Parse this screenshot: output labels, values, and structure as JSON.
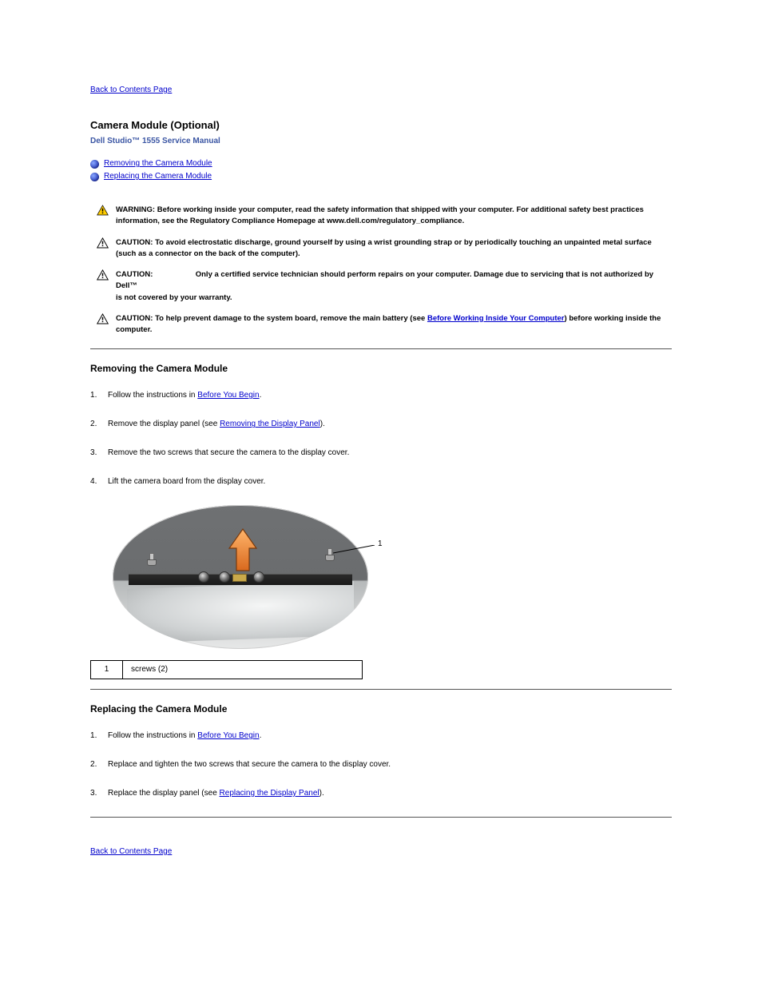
{
  "nav": {
    "back_top": "Back to Contents Page",
    "back_bottom": "Back to Contents Page"
  },
  "header": {
    "title": "Camera Module (Optional)",
    "subtitle": "Dell Studio™ 1555 Service Manual"
  },
  "toc": [
    {
      "label": "Removing the Camera Module"
    },
    {
      "label": "Replacing the Camera Module"
    }
  ],
  "notices": {
    "warning": "WARNING: Before working inside your computer, read the safety information that shipped with your computer. For additional safety best practices information, see the Regulatory Compliance Homepage at www.dell.com/regulatory_compliance.",
    "caution_esd": "CAUTION: To avoid electrostatic discharge, ground yourself by using a wrist grounding strap or by periodically touching an unpainted metal surface (such as a connector on the back of the computer).",
    "caution_tech_line1": "CAUTION:",
    "caution_tech_line1_cont": "Only a certified service technician should perform repairs on your computer. Damage due to servicing that is not authorized by Dell™",
    "caution_tech_line2": "is not covered by your warranty.",
    "caution_battery_prefix": "CAUTION: To help prevent damage to the system board, remove the main battery (see ",
    "caution_battery_link": "Before Working Inside Your Computer",
    "caution_battery_suffix": ") before working inside the computer."
  },
  "sections": {
    "remove": {
      "heading": "Removing the Camera Module",
      "steps": [
        {
          "prefix": "Follow the instructions in ",
          "link": "Before You Begin",
          "suffix": "."
        },
        {
          "prefix": "Remove the display panel (see ",
          "link": "Removing the Display Panel",
          "suffix": ")."
        },
        {
          "prefix": "Remove the two screws that secure the camera to the display cover.",
          "link": "",
          "suffix": ""
        },
        {
          "prefix": "Lift the camera board from the display cover.",
          "link": "",
          "suffix": ""
        }
      ],
      "legend": {
        "num": "1",
        "text": "screws (2)"
      },
      "callout_num": "1"
    },
    "replace": {
      "heading": "Replacing the Camera Module",
      "steps": [
        {
          "prefix": "Follow the instructions in ",
          "link": "Before You Begin",
          "suffix": "."
        },
        {
          "prefix": "Replace and tighten the two screws that secure the camera to the display cover.",
          "link": "",
          "suffix": ""
        },
        {
          "prefix": "Replace the display panel (see ",
          "link": "Replacing the Display Panel",
          "suffix": ")."
        }
      ]
    }
  }
}
